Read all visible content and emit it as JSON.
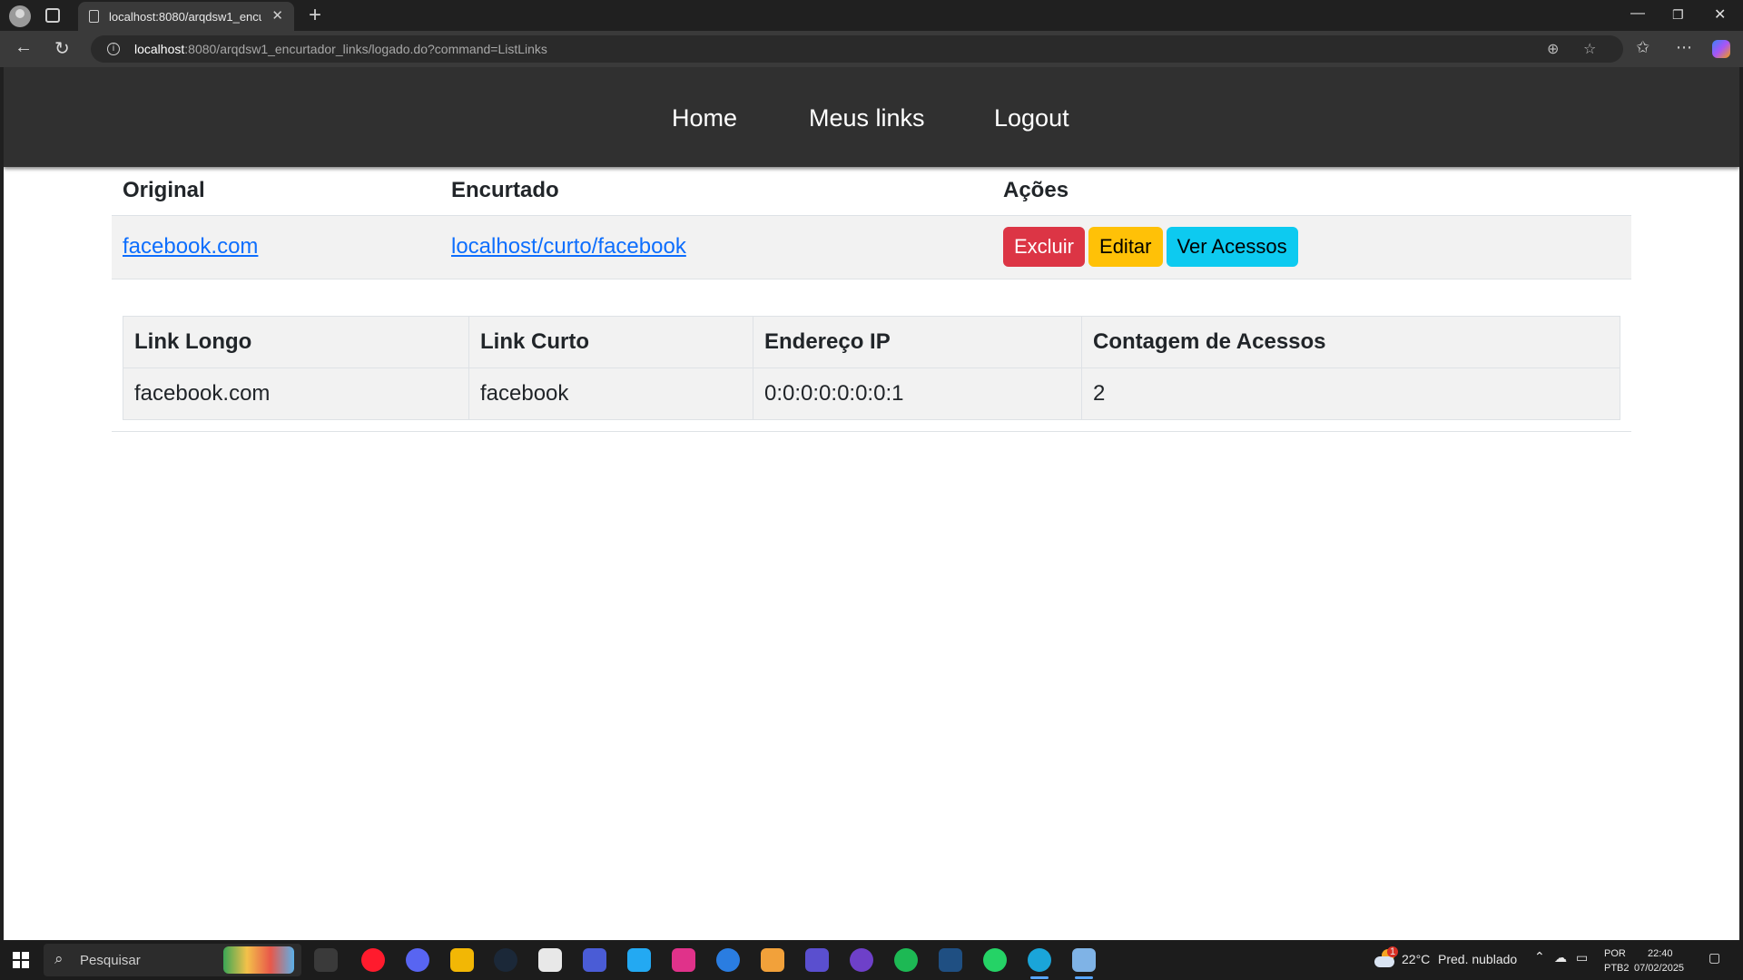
{
  "browser": {
    "tab_title": "localhost:8080/arqdsw1_encurtad",
    "url_host": "localhost",
    "url_rest": ":8080/arqdsw1_encurtador_links/logado.do?command=ListLinks"
  },
  "nav": {
    "home": "Home",
    "meus_links": "Meus links",
    "logout": "Logout"
  },
  "links_table": {
    "headers": [
      "Original",
      "Encurtado",
      "Ações"
    ],
    "rows": [
      {
        "original": "facebook.com",
        "encurtado": "localhost/curto/facebook",
        "actions": {
          "excluir": "Excluir",
          "editar": "Editar",
          "ver_acessos": "Ver Acessos"
        }
      }
    ],
    "colors": {
      "link": "#0d6efd",
      "danger": "#dc3545",
      "warning": "#ffc107",
      "info": "#0dcaf0"
    }
  },
  "access_table": {
    "headers": [
      "Link Longo",
      "Link Curto",
      "Endereço IP",
      "Contagem de Acessos"
    ],
    "rows": [
      {
        "link_longo": "facebook.com",
        "link_curto": "facebook",
        "ip": "0:0:0:0:0:0:0:1",
        "contagem": "2"
      }
    ]
  },
  "taskbar": {
    "search_placeholder": "Pesquisar",
    "weather_temp": "22°C",
    "weather_desc": "Pred. nublado",
    "lang_top": "POR",
    "lang_bottom": "PTB2",
    "time": "22:40",
    "date": "07/02/2025",
    "weather_badge": "1"
  }
}
